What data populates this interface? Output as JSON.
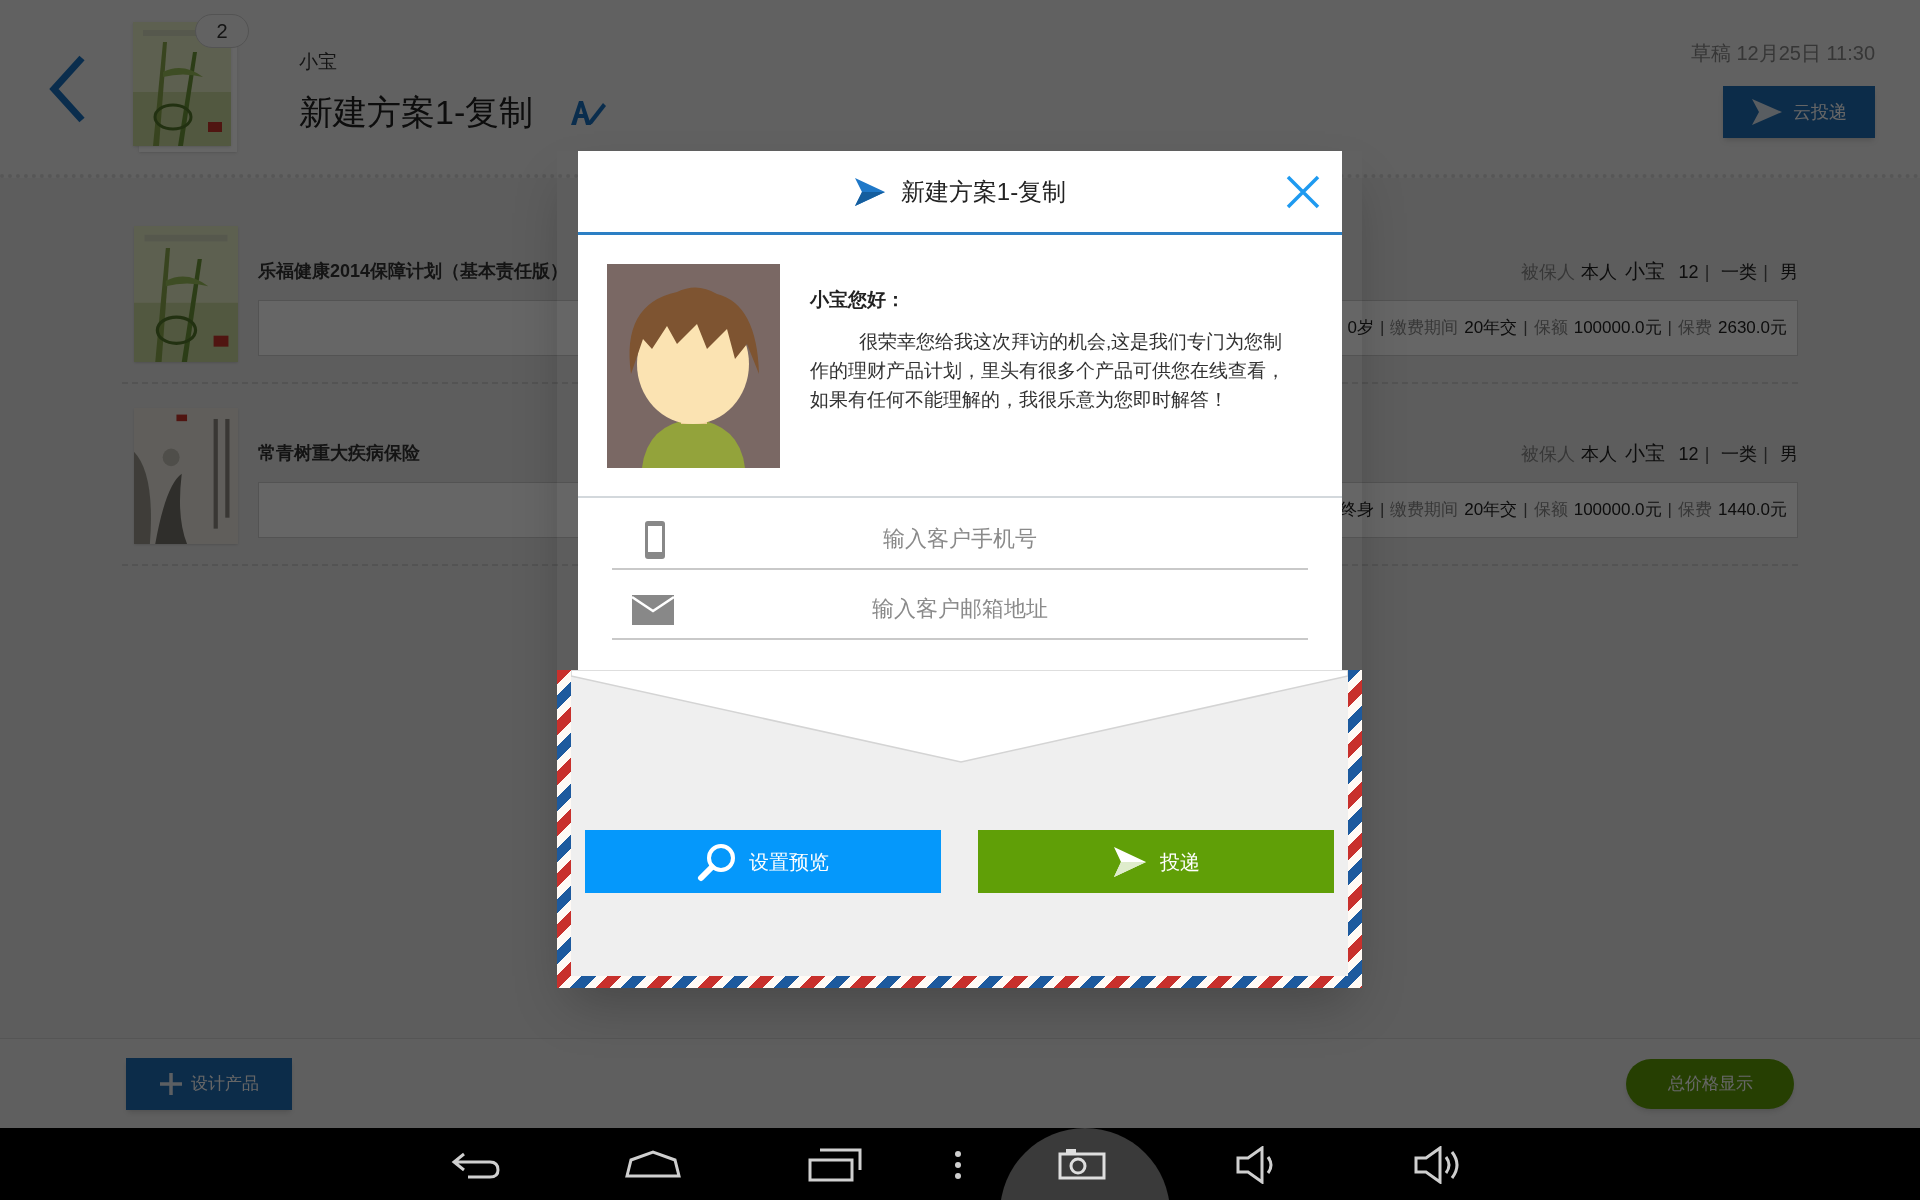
{
  "header": {
    "badge": "2",
    "customer": "小宝",
    "title": "新建方案1-复制",
    "draft_time": "草稿 12月25日 11:30",
    "cloud_send_button": "云投递"
  },
  "products": [
    {
      "name": "乐福健康2014保障计划（基本责任版）",
      "insured": [
        {
          "kind": "label",
          "text": "被保人"
        },
        {
          "kind": "value",
          "text": "本人"
        },
        {
          "kind": "name",
          "text": "小宝"
        },
        {
          "kind": "value",
          "text": "12"
        },
        {
          "kind": "sep",
          "text": "|"
        },
        {
          "kind": "value",
          "text": "一类"
        },
        {
          "kind": "sep",
          "text": "|"
        },
        {
          "kind": "value",
          "text": "男"
        }
      ],
      "details": [
        {
          "kind": "value",
          "text": "0岁"
        },
        {
          "kind": "sep",
          "text": "|"
        },
        {
          "kind": "label",
          "text": "缴费期间"
        },
        {
          "kind": "value",
          "text": "20年交"
        },
        {
          "kind": "sep",
          "text": "|"
        },
        {
          "kind": "label",
          "text": "保额"
        },
        {
          "kind": "value",
          "text": "100000.0元"
        },
        {
          "kind": "sep",
          "text": "|"
        },
        {
          "kind": "label",
          "text": "保费"
        },
        {
          "kind": "value",
          "text": "2630.0元"
        }
      ]
    },
    {
      "name": "常青树重大疾病保险",
      "insured": [
        {
          "kind": "label",
          "text": "被保人"
        },
        {
          "kind": "value",
          "text": "本人"
        },
        {
          "kind": "name",
          "text": "小宝"
        },
        {
          "kind": "value",
          "text": "12"
        },
        {
          "kind": "sep",
          "text": "|"
        },
        {
          "kind": "value",
          "text": "一类"
        },
        {
          "kind": "sep",
          "text": "|"
        },
        {
          "kind": "value",
          "text": "男"
        }
      ],
      "details": [
        {
          "kind": "value",
          "text": "终身"
        },
        {
          "kind": "sep",
          "text": "|"
        },
        {
          "kind": "label",
          "text": "缴费期间"
        },
        {
          "kind": "value",
          "text": "20年交"
        },
        {
          "kind": "sep",
          "text": "|"
        },
        {
          "kind": "label",
          "text": "保额"
        },
        {
          "kind": "value",
          "text": "100000.0元"
        },
        {
          "kind": "sep",
          "text": "|"
        },
        {
          "kind": "label",
          "text": "保费"
        },
        {
          "kind": "value",
          "text": "1440.0元"
        }
      ]
    }
  ],
  "footer": {
    "design_button": "设计产品",
    "total_button": "总价格显示"
  },
  "dialog": {
    "title": "新建方案1-复制",
    "greeting": "小宝您好：",
    "message": "很荣幸您给我这次拜访的机会,这是我们专门为您制作的理财产品计划，里头有很多个产品可供您在线查看，如果有任何不能理解的，我很乐意为您即时解答！",
    "phone_placeholder": "输入客户手机号",
    "email_placeholder": "输入客户邮箱地址",
    "preview_button": "设置预览",
    "send_button": "投递"
  }
}
